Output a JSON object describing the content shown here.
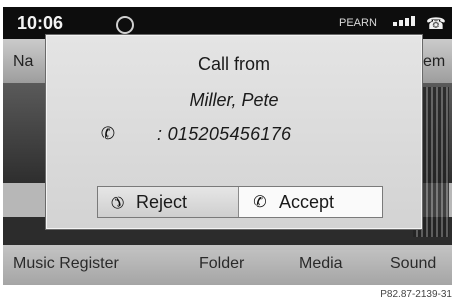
{
  "status_bar": {
    "time": "10:06",
    "network": "PEARN",
    "clock_icon": "clock-icon",
    "signal_icon": "signal-strength-icon",
    "handset_icon": "phone-handset-icon"
  },
  "menu_bar": {
    "left_fragment": "Na",
    "right_fragment": "em"
  },
  "dialog": {
    "title": "Call from",
    "caller_name": "Miller, Pete",
    "caller_number": ": 015205456176",
    "phone_icon": "phone-icon",
    "reject_label": "Reject",
    "reject_icon": "hang-up-icon",
    "accept_label": "Accept",
    "accept_icon": "phone-icon"
  },
  "bottom_menu": {
    "items": [
      "Music Register",
      "Folder",
      "Media",
      "Sound"
    ]
  },
  "caption": "P82.87-2139-31",
  "colors": {
    "screen_bg": "#3f3f3f",
    "dialog_bg": "#dcdcdc",
    "menu_bg": "#b5b5b5",
    "status_bg": "#0d0d0d"
  }
}
